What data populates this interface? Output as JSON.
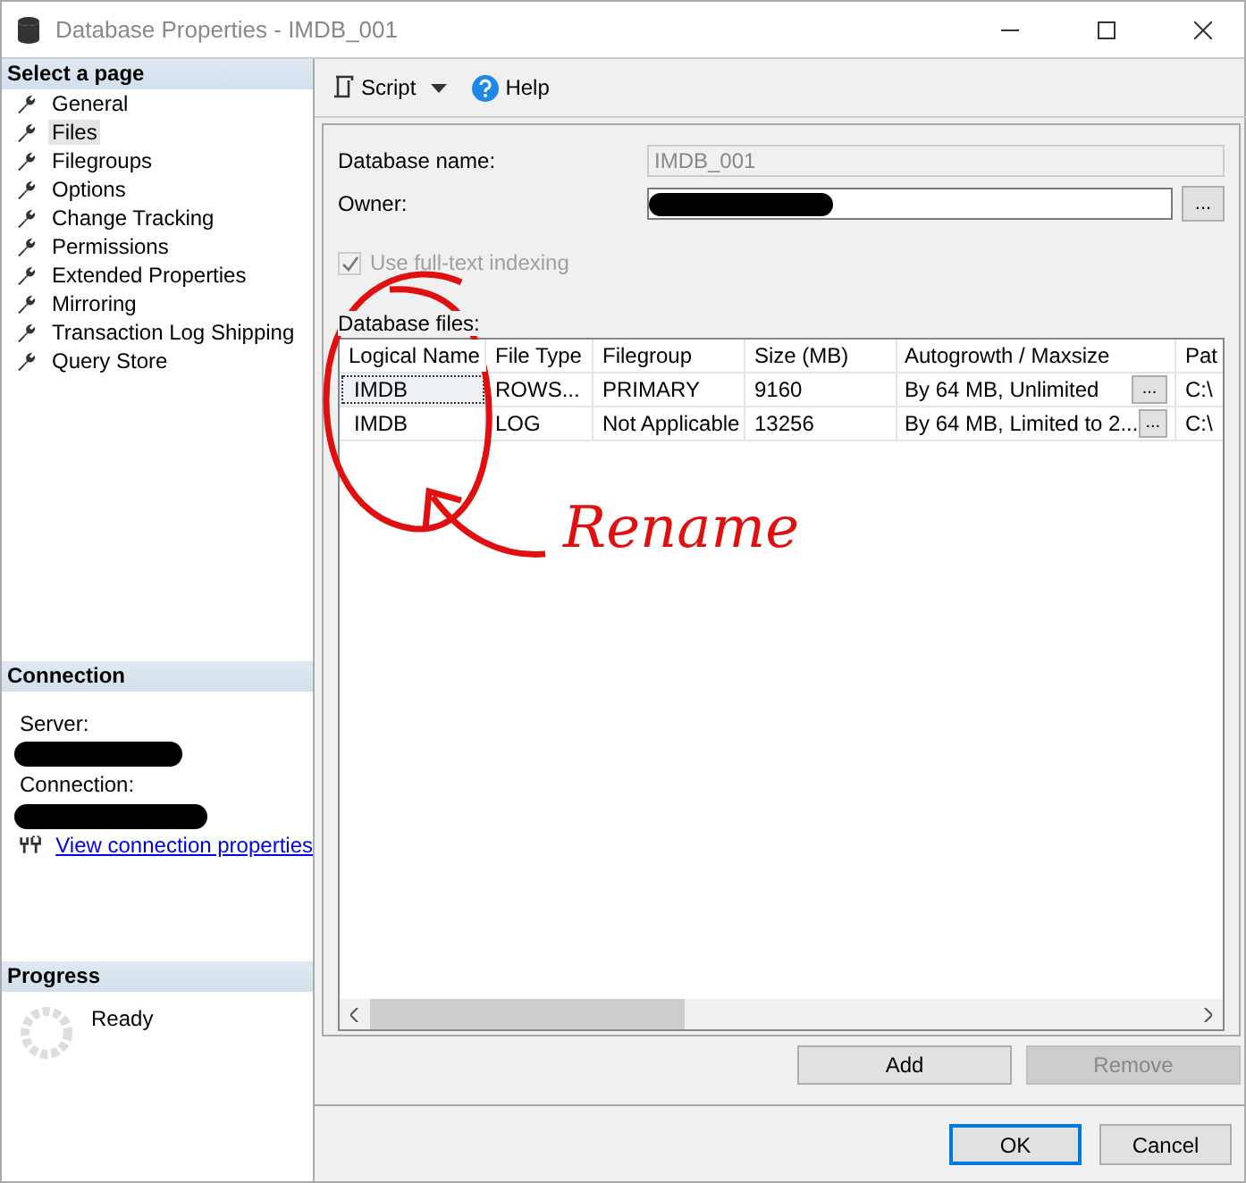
{
  "window": {
    "title": "Database Properties - IMDB_001"
  },
  "sidebar": {
    "header": "Select a page",
    "items": [
      {
        "label": "General",
        "selected": false
      },
      {
        "label": "Files",
        "selected": true
      },
      {
        "label": "Filegroups",
        "selected": false
      },
      {
        "label": "Options",
        "selected": false
      },
      {
        "label": "Change Tracking",
        "selected": false
      },
      {
        "label": "Permissions",
        "selected": false
      },
      {
        "label": "Extended Properties",
        "selected": false
      },
      {
        "label": "Mirroring",
        "selected": false
      },
      {
        "label": "Transaction Log Shipping",
        "selected": false
      },
      {
        "label": "Query Store",
        "selected": false
      }
    ],
    "connection": {
      "header": "Connection",
      "server_label": "Server:",
      "connection_label": "Connection:",
      "link": "View connection properties"
    },
    "progress": {
      "header": "Progress",
      "status": "Ready"
    }
  },
  "toolbar": {
    "script": "Script",
    "help": "Help"
  },
  "form": {
    "database_name_label": "Database name:",
    "database_name": "IMDB_001",
    "owner_label": "Owner:",
    "owner_button": "...",
    "fulltext": {
      "label": "Use full-text indexing",
      "checked": true,
      "disabled": true
    },
    "files_label": "Database files:"
  },
  "table": {
    "columns": [
      "Logical Name",
      "File Type",
      "Filegroup",
      "Size (MB)",
      "Autogrowth / Maxsize",
      "Pat"
    ],
    "rows": [
      {
        "cells": [
          "IMDB",
          "ROWS...",
          "PRIMARY",
          "9160",
          "By 64 MB, Unlimited",
          "C:\\"
        ],
        "button": "...",
        "selected": true
      },
      {
        "cells": [
          "IMDB",
          "LOG",
          "Not Applicable",
          "13256",
          "By 64 MB, Limited to 2...",
          "C:\\"
        ],
        "button": "...",
        "selected": false
      }
    ]
  },
  "file_buttons": [
    {
      "label": "Add",
      "disabled": false
    },
    {
      "label": "Remove",
      "disabled": true
    }
  ],
  "dialog_buttons": [
    {
      "label": "OK",
      "default": true
    },
    {
      "label": "Cancel",
      "default": false
    }
  ],
  "annotation": {
    "text": "Rename"
  }
}
